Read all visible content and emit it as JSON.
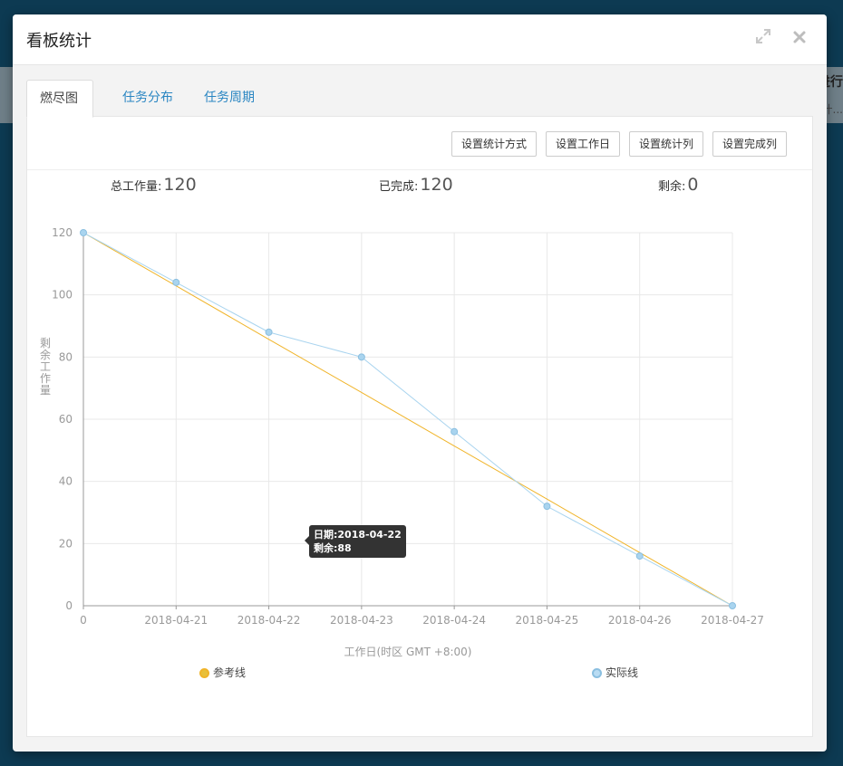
{
  "backdrop": {
    "partial_title": "进行",
    "partial_sub": "计..."
  },
  "modal": {
    "title": "看板统计",
    "expand_icon": "expand-icon",
    "close_icon": "close-icon"
  },
  "tabs": [
    {
      "label": "燃尽图",
      "active": true
    },
    {
      "label": "任务分布",
      "active": false
    },
    {
      "label": "任务周期",
      "active": false
    }
  ],
  "toolbar": {
    "buttons": [
      "设置统计方式",
      "设置工作日",
      "设置统计列",
      "设置完成列"
    ]
  },
  "stats": {
    "total_label": "总工作量:",
    "total_value": "120",
    "done_label": "已完成:",
    "done_value": "120",
    "remaining_label": "剩余:",
    "remaining_value": "0"
  },
  "tooltip": {
    "date_line": "日期:2018-04-22",
    "remaining_line": "剩余:88"
  },
  "colors": {
    "reference": "#f0b429",
    "actual": "#a9d4ef",
    "actual_point": "#a9d4ef",
    "grid": "#e8e8e8",
    "axis": "#999999"
  },
  "chart_data": {
    "type": "line",
    "ylabel": "剩余工作量",
    "xlabel": "工作日(时区 GMT +8:00)",
    "categories": [
      "0",
      "2018-04-21",
      "2018-04-22",
      "2018-04-23",
      "2018-04-24",
      "2018-04-25",
      "2018-04-26",
      "2018-04-27"
    ],
    "ylim": [
      0,
      120
    ],
    "yticks": [
      0,
      20,
      40,
      60,
      80,
      100,
      120
    ],
    "grid": true,
    "legend": "bottom",
    "series": [
      {
        "name": "参考线",
        "values": [
          120,
          102.9,
          85.7,
          68.6,
          51.4,
          34.3,
          17.1,
          0
        ]
      },
      {
        "name": "实际线",
        "values": [
          120,
          104,
          88,
          80,
          56,
          32,
          16,
          0
        ]
      }
    ]
  }
}
